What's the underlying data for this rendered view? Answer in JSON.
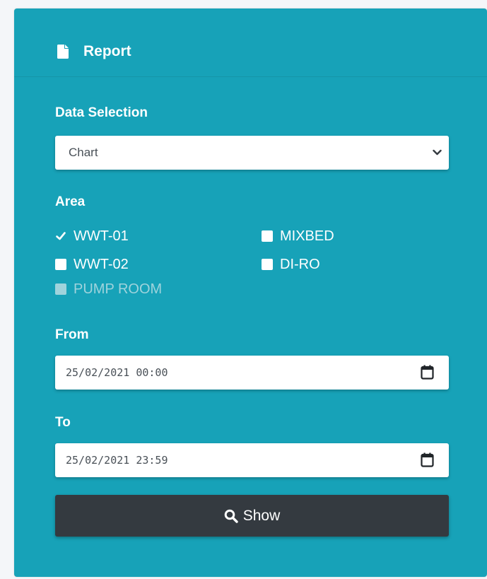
{
  "card": {
    "title": "Report",
    "icon": "file-icon",
    "accent_color": "#17a2b8"
  },
  "data_selection": {
    "label": "Data Selection",
    "selected": "Chart"
  },
  "area": {
    "label": "Area",
    "options": [
      {
        "label": "WWT-01",
        "checked": true,
        "disabled": false
      },
      {
        "label": "MIXBED",
        "checked": false,
        "disabled": false
      },
      {
        "label": "WWT-02",
        "checked": false,
        "disabled": false
      },
      {
        "label": "DI-RO",
        "checked": false,
        "disabled": false
      },
      {
        "label": "PUMP ROOM",
        "checked": false,
        "disabled": true
      }
    ]
  },
  "from": {
    "label": "From",
    "value": "25/02/2021 00:00"
  },
  "to": {
    "label": "To",
    "value": "25/02/2021 23:59"
  },
  "show_button": {
    "label": "Show",
    "icon": "search-icon",
    "color": "#343a40"
  }
}
